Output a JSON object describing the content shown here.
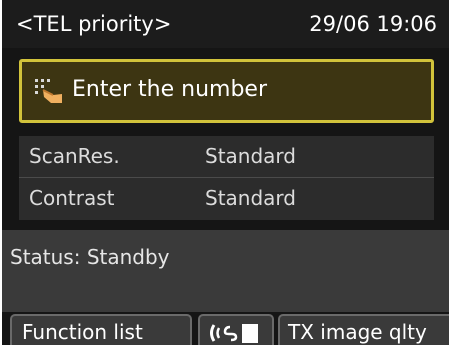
{
  "header": {
    "mode_title": "<TEL priority>",
    "clock": "29/06 19:06"
  },
  "number_entry": {
    "icon": "keypad-finger-icon",
    "label": "Enter the number"
  },
  "settings": [
    {
      "name": "ScanRes.",
      "value": "Standard"
    },
    {
      "name": "Contrast",
      "value": "Standard"
    }
  ],
  "status": {
    "text": "Status: Standby"
  },
  "softkeys": {
    "function_list": "Function list",
    "hook_icon": "handset-document-icon",
    "tx_quality": "TX image qlty"
  },
  "colors": {
    "background": "#151515",
    "accent_border": "#d2c33b",
    "accent_fill": "#3d3512"
  }
}
